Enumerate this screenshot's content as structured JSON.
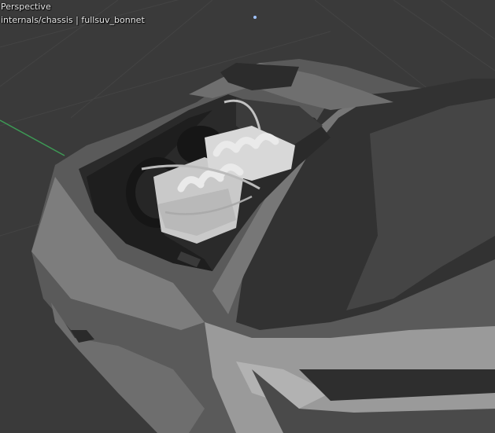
{
  "viewport": {
    "view_label": "Perspective",
    "object_label": "internals/chassis | fullsuv_bonnet"
  },
  "colors": {
    "background": "#3a3a3a",
    "grid_line": "#444444",
    "y_axis": "#3d9a55",
    "body_light": "#8a8a8a",
    "body_dark": "#3c3c3c",
    "engine": "#d4d4d4"
  },
  "icons": [
    "3d-cursor-icon"
  ]
}
